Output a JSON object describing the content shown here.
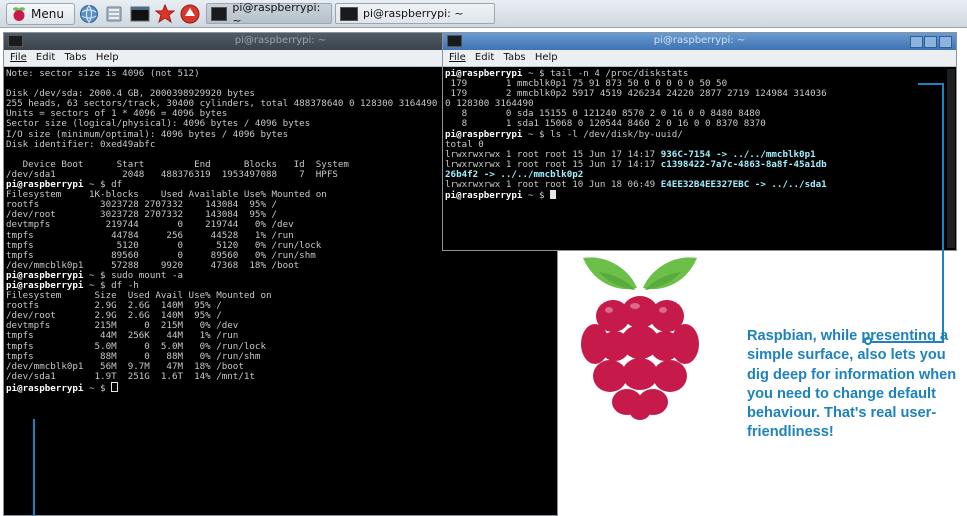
{
  "taskbar": {
    "menu_label": "Menu",
    "tasks": [
      {
        "label": "pi@raspberrypi: ~"
      },
      {
        "label": "pi@raspberrypi: ~"
      }
    ]
  },
  "left_terminal": {
    "title": "pi@raspberrypi: ~",
    "menu": [
      "File",
      "Edit",
      "Tabs",
      "Help"
    ],
    "lines": [
      "Note: sector size is 4096 (not 512)",
      "",
      "Disk /dev/sda: 2000.4 GB, 2000398929920 bytes",
      "255 heads, 63 sectors/track, 30400 cylinders, total 488378640 0 128300 3164490",
      "Units = sectors of 1 * 4096 = 4096 bytes",
      "Sector size (logical/physical): 4096 bytes / 4096 bytes",
      "I/O size (minimum/optimal): 4096 bytes / 4096 bytes",
      "Disk identifier: 0xed49abfc",
      "",
      "   Device Boot      Start         End      Blocks   Id  System",
      "/dev/sda1            2048   488376319  1953497088    7  HPFS",
      {
        "prompt": "pi@raspberrypi",
        "cmd": " ~ $ df"
      },
      "Filesystem     1K-blocks    Used Available Use% Mounted on",
      "rootfs           3023728 2707332    143084  95% /",
      "/dev/root        3023728 2707332    143084  95% /",
      "devtmpfs          219744       0    219744   0% /dev",
      "tmpfs              44784     256     44528   1% /run",
      "tmpfs               5120       0      5120   0% /run/lock",
      "tmpfs              89560       0     89560   0% /run/shm",
      "/dev/mmcblk0p1     57288    9920     47368  18% /boot",
      {
        "prompt": "pi@raspberrypi",
        "cmd": " ~ $ sudo mount -a"
      },
      {
        "prompt": "pi@raspberrypi",
        "cmd": " ~ $ df -h"
      },
      "Filesystem      Size  Used Avail Use% Mounted on",
      "rootfs          2.9G  2.6G  140M  95% /",
      "/dev/root       2.9G  2.6G  140M  95% /",
      "devtmpfs        215M     0  215M   0% /dev",
      "tmpfs            44M  256K   44M   1% /run",
      "tmpfs           5.0M     0  5.0M   0% /run/lock",
      "tmpfs            88M     0   88M   0% /run/shm",
      "/dev/mmcblk0p1   56M  9.7M   47M  18% /boot",
      "/dev/sda1       1.9T  251G  1.6T  14% /mnt/1t",
      {
        "prompt": "pi@raspberrypi",
        "cmd": " ~ $ ",
        "cursor": "hollow"
      }
    ]
  },
  "right_terminal": {
    "title": "pi@raspberrypi: ~",
    "menu": [
      "File",
      "Edit",
      "Tabs",
      "Help"
    ],
    "lines": [
      {
        "prompt": "pi@raspberrypi",
        "cmd": " ~ $ tail -n 4 /proc/diskstats"
      },
      " 179       1 mmcblk0p1 75 91 873 50 0 0 0 0 0 50 50",
      " 179       2 mmcblk0p2 5917 4519 426234 24220 2877 2719 124984 314036",
      "0 128300 3164490",
      "   8       0 sda 15155 0 121240 8570 2 0 16 0 0 8480 8480",
      "   8       1 sda1 15068 0 120544 8460 2 0 16 0 0 8370 8370",
      {
        "prompt": "pi@raspberrypi",
        "cmd": " ~ $ ls -l /dev/disk/by-uuid/"
      },
      "total 0",
      {
        "text": "lrwxrwxrwx 1 root root 15 Jun 17 14:17 ",
        "hl": "936C-7154",
        "rest": " -> ../../mmcblk0p1"
      },
      {
        "text": "lrwxrwxrwx 1 root root 15 Jun 17 14:17 ",
        "hl": "c1398422-7a7c-4863-8a8f-45a1db",
        "rest": ""
      },
      {
        "text": "",
        "hl": "26b4f2",
        "rest": " -> ../../mmcblk0p2"
      },
      {
        "text": "lrwxrwxrwx 1 root root 10 Jun 18 06:49 ",
        "hl": "E4EE32B4EE327EBC",
        "rest": " -> ../../sda1"
      },
      {
        "prompt": "pi@raspberrypi",
        "cmd": " ~ $ ",
        "cursor": "solid"
      }
    ]
  },
  "callout": "Raspbian, while presenting a simple surface, also lets you dig deep for information when you need to change default behaviour. That's real user-friendliness!",
  "colors": {
    "callout": "#1d82bd",
    "raspberry_red": "#c51a4a",
    "leaf_green": "#6cc04a"
  }
}
